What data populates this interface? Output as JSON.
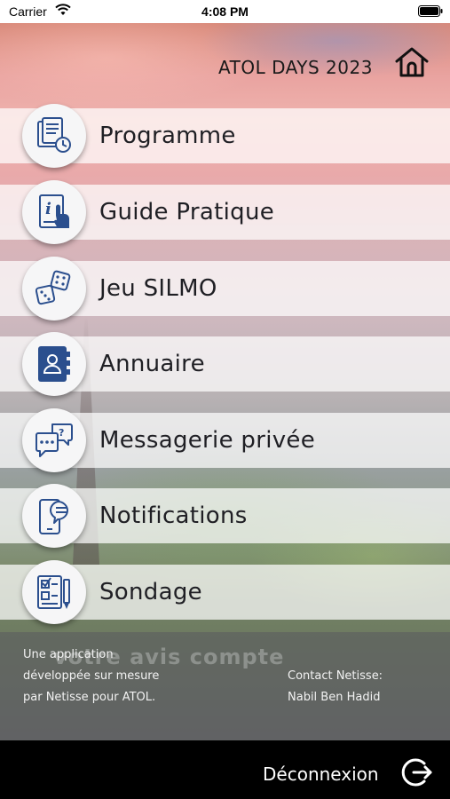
{
  "status_bar": {
    "carrier": "Carrier",
    "time": "4:08 PM"
  },
  "header": {
    "title": "ATOL DAYS 2023",
    "home_icon": "home-icon"
  },
  "menu": {
    "items": [
      {
        "label": "Programme",
        "icon": "program-document-icon"
      },
      {
        "label": "Guide Pratique",
        "icon": "guide-info-icon"
      },
      {
        "label": "Jeu SILMO",
        "icon": "dice-icon"
      },
      {
        "label": "Annuaire",
        "icon": "address-book-icon"
      },
      {
        "label": "Messagerie privée",
        "icon": "chat-bubbles-icon"
      },
      {
        "label": "Notifications",
        "icon": "phone-notification-icon"
      },
      {
        "label": "Sondage",
        "icon": "survey-icon"
      }
    ]
  },
  "footer": {
    "watermark": "votre avis compte",
    "credit_lines": [
      "Une application",
      "développée sur mesure",
      "par Netisse pour ATOL."
    ],
    "contact_lines": [
      "Contact Netisse:",
      "Nabil Ben Hadid"
    ]
  },
  "bottom_bar": {
    "logout_label": "Déconnexion"
  },
  "colors": {
    "icon_blue": "#2b4f8e",
    "label_text": "#1f1f24",
    "bottom_bar": "#000000"
  }
}
